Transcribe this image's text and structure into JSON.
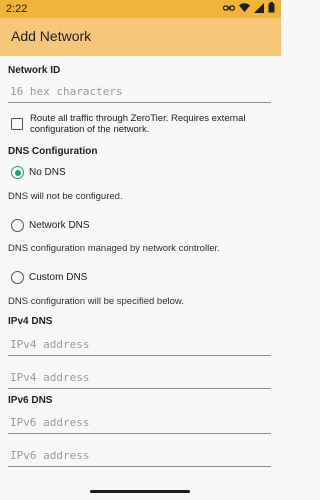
{
  "status_bar": {
    "time": "2:22",
    "icons": [
      "link-icon",
      "wifi-icon",
      "signal-icon",
      "battery-icon"
    ]
  },
  "app_bar": {
    "title": "Add Network",
    "color": "#f6c779"
  },
  "network_id": {
    "label": "Network ID",
    "placeholder": "16 hex characters",
    "value": ""
  },
  "route_all": {
    "checked": false,
    "label": "Route all traffic through ZeroTier. Requires external configuration of the network."
  },
  "dns": {
    "section_label": "DNS Configuration",
    "options": [
      {
        "label": "No DNS",
        "selected": true,
        "description": "DNS will not be configured."
      },
      {
        "label": "Network DNS",
        "selected": false,
        "description": "DNS configuration managed by network controller."
      },
      {
        "label": "Custom DNS",
        "selected": false,
        "description": "DNS configuration will be specified below."
      }
    ],
    "accent": "#1a9e7b"
  },
  "ipv4": {
    "label": "IPv4 DNS",
    "fields": [
      {
        "placeholder": "IPv4 address",
        "value": ""
      },
      {
        "placeholder": "IPv4 address",
        "value": ""
      }
    ]
  },
  "ipv6": {
    "label": "IPv6 DNS",
    "fields": [
      {
        "placeholder": "IPv6 address",
        "value": ""
      },
      {
        "placeholder": "IPv6 address",
        "value": ""
      }
    ]
  }
}
